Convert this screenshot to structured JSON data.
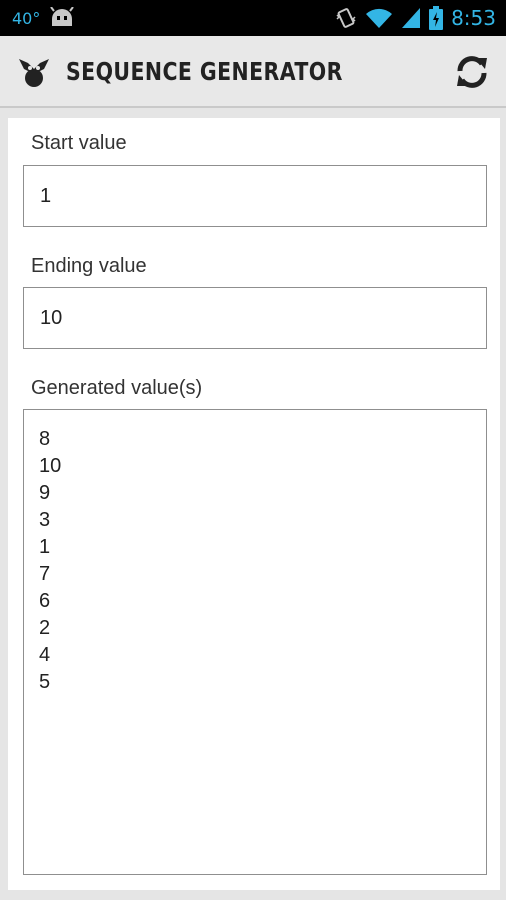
{
  "status_bar": {
    "temperature": "40°",
    "time": "8:53",
    "icons": [
      "android-notification-icon",
      "vibrate-icon",
      "wifi-icon",
      "signal-icon",
      "battery-charging-icon"
    ]
  },
  "action_bar": {
    "title": "SEQUENCE GENERATOR",
    "app_icon": "bear-logo-icon",
    "refresh_icon": "refresh-icon"
  },
  "form": {
    "start_label": "Start value",
    "start_value": "1",
    "end_label": "Ending value",
    "end_value": "10",
    "generated_label": "Generated value(s)",
    "generated_values": [
      "8",
      "10",
      "9",
      "3",
      "1",
      "7",
      "6",
      "2",
      "4",
      "5"
    ]
  },
  "colors": {
    "status_accent": "#33b5e5",
    "action_bar_bg": "#e8e8e8",
    "page_bg": "#e5e5e5"
  }
}
